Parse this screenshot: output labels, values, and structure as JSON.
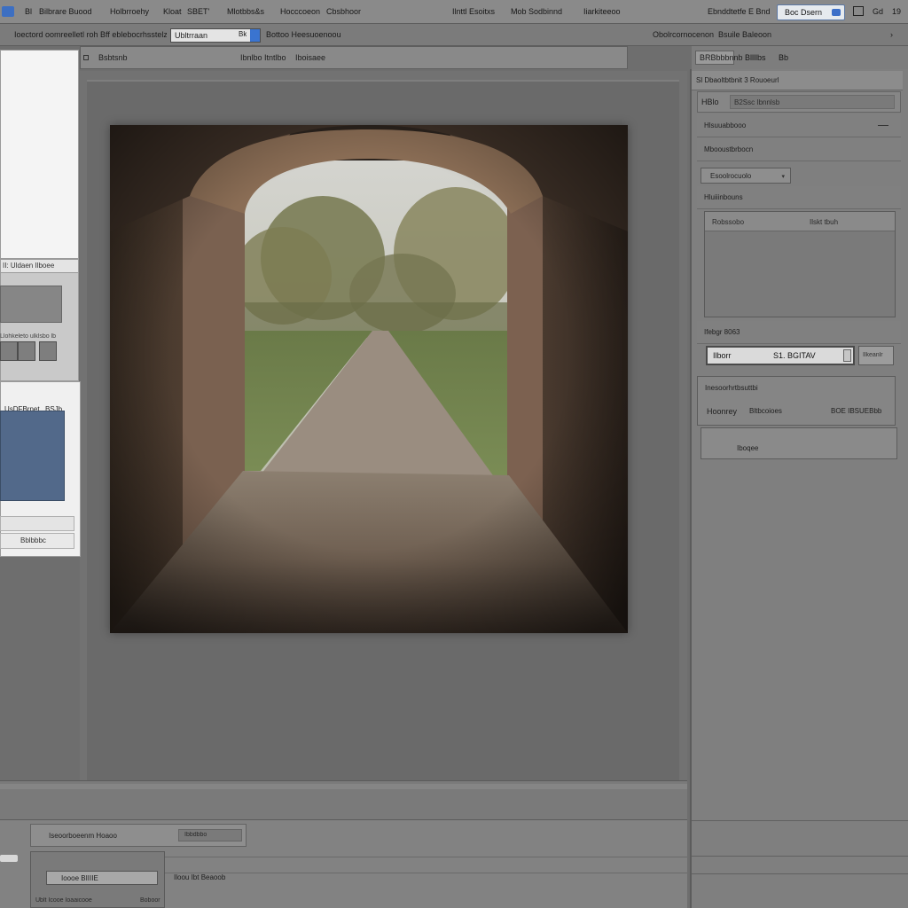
{
  "menubar": {
    "items": [
      "Bl",
      "Bilbrare Buood",
      "Holbrroehy",
      "Kloat",
      "SBET'",
      "Mlotbbs&s",
      "Hocccoeon",
      "Cbsbhoor",
      "Ilnttl Esoitxs",
      "Mob Sodbinnd",
      "Iiarkiteeoo"
    ],
    "account": "Ebnddtetfe E Bndtl",
    "search_label": "Boc Dsern",
    "icons": [
      "window-icon",
      "help-icon"
    ],
    "right_a": "Gd",
    "right_b": "19"
  },
  "options_bar": {
    "label": "Ioectord oomreelletl roh Bff eblebocrhsstelzes",
    "field_value": "Ubltrraan",
    "field_btn": "Bk",
    "label2": "Bottoo Heesuoenoou",
    "right_label": "Obolrcornocenon",
    "right_label2": "Bsuile Baleoon",
    "right_icon": "›"
  },
  "tabbar": {
    "tab1": "Bsbtsnb",
    "tab2": "Ibnlbo Itntlbo",
    "tab3": "Iboisaee"
  },
  "left_panel": {
    "section_title": "II: Uldaen Ilboee",
    "sub_label": "Llohkeleto ulklsbo lb",
    "box2_title": "UsDFBrnet",
    "box2_value": "BSJb.",
    "foot_label": "Bblbbbc"
  },
  "right_panel": {
    "top_tabs": [
      "BRBbbbnnb",
      "Bllllbs",
      "Bb"
    ],
    "header": "Sl Dbaoltbtbnit 3   Rouoeurl",
    "sub_label": "HBlo",
    "sub_value": "B2Ssc Ibnnlsb",
    "row1": "Hlsuuabbooo",
    "row2": "Mbooustbrbocn",
    "select_value": "Esoolrocuolo",
    "row3": "Hluiiinbouns",
    "props_col1": "Robssobo",
    "props_col2": "Ilskt tbuh",
    "row4": "Ifebgr 8063",
    "input_label": "Ilborr",
    "input_value": "S1. BGITAV",
    "apply_label": "Ilkeanlr",
    "group_title": "Inesoorhrtbsuttbi",
    "group_a": "Hoonrey",
    "group_b": "Bltbcoioes",
    "group_c": "BOE IBSUEBbb",
    "footer_label": "Iboqee"
  },
  "bottom_panel": {
    "tab_label": "Iseoorboeenm Hoaoo",
    "tab_pill": "Ibbdbbo",
    "field_value": "Ioooe BIIIIE",
    "status_left": "Ublt Icooe Ioaaicooe",
    "status_right": "Boboor",
    "right_label": "Iloou Ibt Beaoob"
  },
  "colors": {
    "accent": "#3a74d0",
    "panel": "#7f7f7f",
    "canvas": "#6a6a6a"
  }
}
